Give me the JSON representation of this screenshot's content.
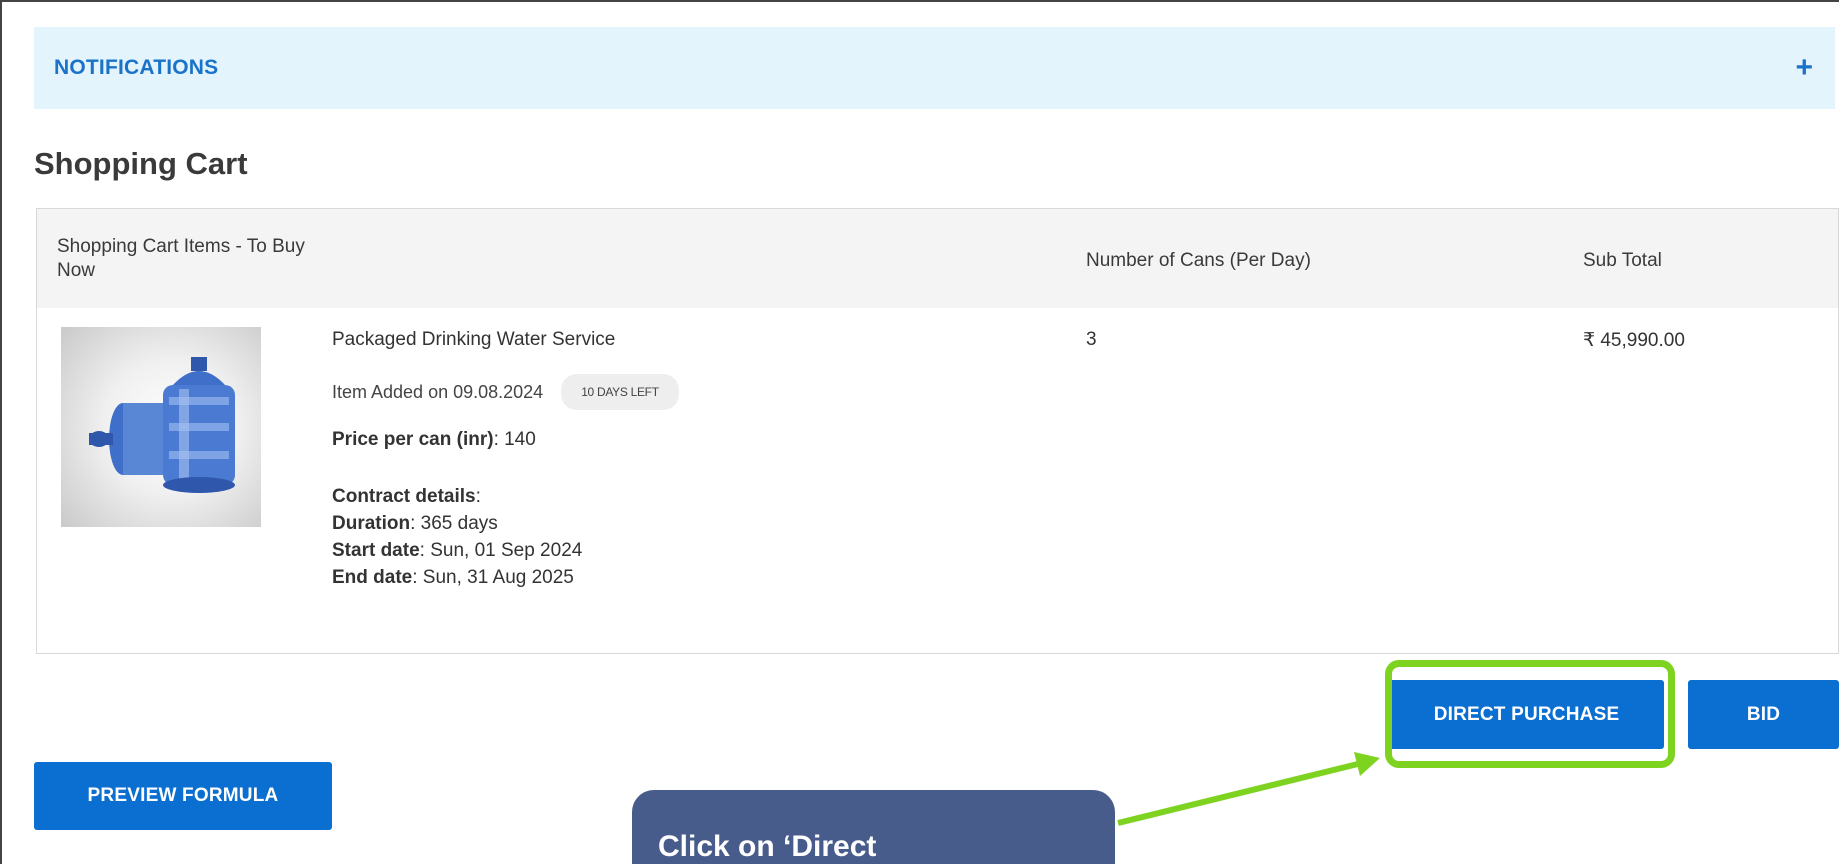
{
  "notifications": {
    "title": "NOTIFICATIONS",
    "expand_icon": "plus-icon"
  },
  "page_title": "Shopping Cart",
  "cart": {
    "headers": {
      "items": "Shopping Cart Items - To Buy Now",
      "cans": "Number of Cans (Per Day)",
      "subtotal": "Sub Total"
    },
    "item": {
      "name": "Packaged Drinking Water Service",
      "added": "Item Added on 09.08.2024",
      "days_left": "10 DAYS LEFT",
      "price_label": "Price per can (inr)",
      "price_value": ": 140",
      "contract_label": "Contract details",
      "contract_suffix": ":",
      "duration_label": "Duration",
      "duration_value": ": 365 days",
      "start_label": "Start date",
      "start_value": ": Sun, 01 Sep 2024",
      "end_label": "End date",
      "end_value": ": Sun, 31 Aug 2025",
      "cans": "3",
      "subtotal": "₹ 45,990.00"
    }
  },
  "buttons": {
    "direct_purchase": "DIRECT PURCHASE",
    "bid": "BID",
    "preview_formula": "PREVIEW FORMULA"
  },
  "callout": {
    "text": "Click on ‘Direct"
  },
  "colors": {
    "accent": "#0b6fd2",
    "notifications_bg": "#e3f4fc",
    "highlight": "#7ed321",
    "callout_bg": "#485c8c"
  }
}
